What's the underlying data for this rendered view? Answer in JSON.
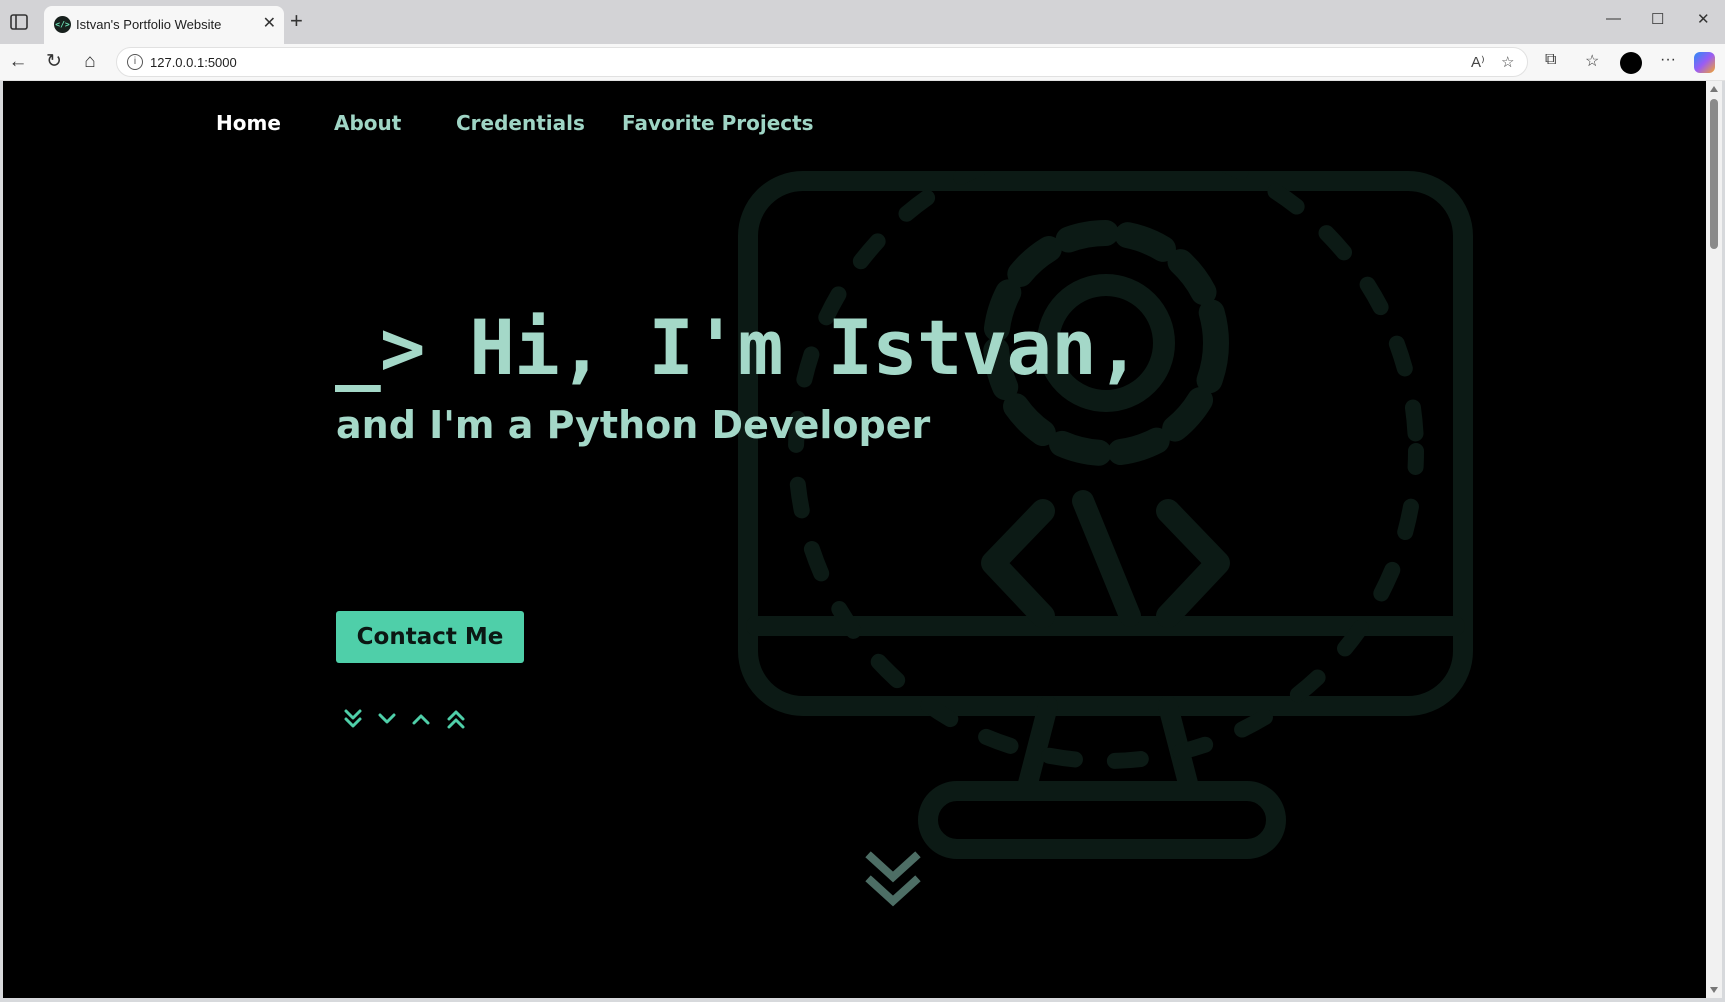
{
  "browser": {
    "tab_title": "Istvan's Portfolio Website",
    "tab_favicon_text": "</>",
    "url": "127.0.0.1:5000"
  },
  "site": {
    "nav": [
      {
        "label": "Home",
        "active": true
      },
      {
        "label": "About",
        "active": false
      },
      {
        "label": "Credentials",
        "active": false
      },
      {
        "label": "Favorite Projects",
        "active": false
      }
    ],
    "hero": {
      "title": "_> Hi, I'm Istvan,",
      "subtitle": "and I'm a Python Developer",
      "cta_label": "Contact Me"
    },
    "scroll_controls": [
      "chevrons-down-icon",
      "chevron-down-icon",
      "chevron-up-icon",
      "chevrons-up-icon"
    ],
    "background_illustration": "monitor-gear-code-icon",
    "scroll_hint": "chevrons-down-icon"
  },
  "colors": {
    "page_background": "#000000",
    "text_accent": "#a4d8c8",
    "button": "#4fcfa9",
    "illustration_stroke": "#0c1a15"
  }
}
